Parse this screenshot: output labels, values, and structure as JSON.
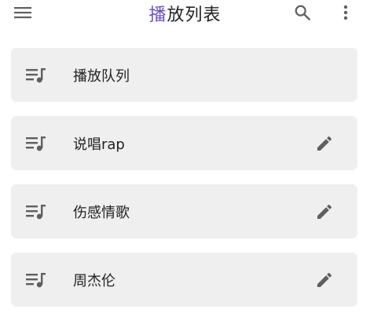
{
  "header": {
    "title_accent": "播",
    "title_rest": "放列表",
    "menu_icon": "menu-icon",
    "search_icon": "search-icon",
    "more_icon": "more-vert-icon"
  },
  "playlists": [
    {
      "label": "播放队列",
      "icon": "playlist-music-icon",
      "editable": false
    },
    {
      "label": "说唱rap",
      "icon": "playlist-music-icon",
      "editable": true
    },
    {
      "label": "伤感情歌",
      "icon": "playlist-music-icon",
      "editable": true
    },
    {
      "label": "周杰伦",
      "icon": "playlist-music-icon",
      "editable": true
    }
  ],
  "colors": {
    "accent": "#6a4fc9",
    "card_bg": "#efefef",
    "icon": "#5f5f5f"
  }
}
